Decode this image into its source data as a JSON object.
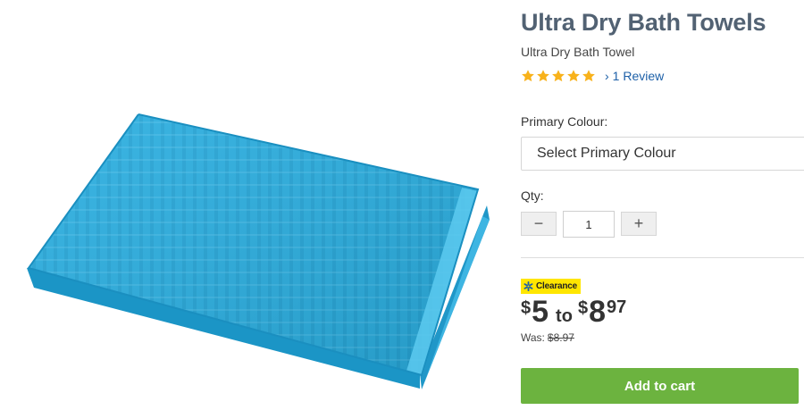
{
  "product": {
    "title": "Ultra Dry Bath Towels",
    "subtitle": "Ultra Dry Bath Towel",
    "image_icon": "product-image-towel",
    "towel_color": "#29aede"
  },
  "rating": {
    "stars": 5,
    "max_stars": 5,
    "star_color": "#f8b21b",
    "review_chevron": "›",
    "review_text": "1 Review"
  },
  "options": {
    "colour_label": "Primary Colour:",
    "colour_placeholder": "Select Primary Colour"
  },
  "quantity": {
    "label": "Qty:",
    "value": "1",
    "minus": "−",
    "plus": "+"
  },
  "price": {
    "badge": "Clearance",
    "badge_color": "#ffe600",
    "currency": "$",
    "low": "5",
    "to": "to",
    "high_dollars": "8",
    "high_cents": "97",
    "was_label": "Was:",
    "was_price": "$8.97"
  },
  "cart": {
    "button_label": "Add to cart",
    "button_color": "#6cb33f"
  }
}
